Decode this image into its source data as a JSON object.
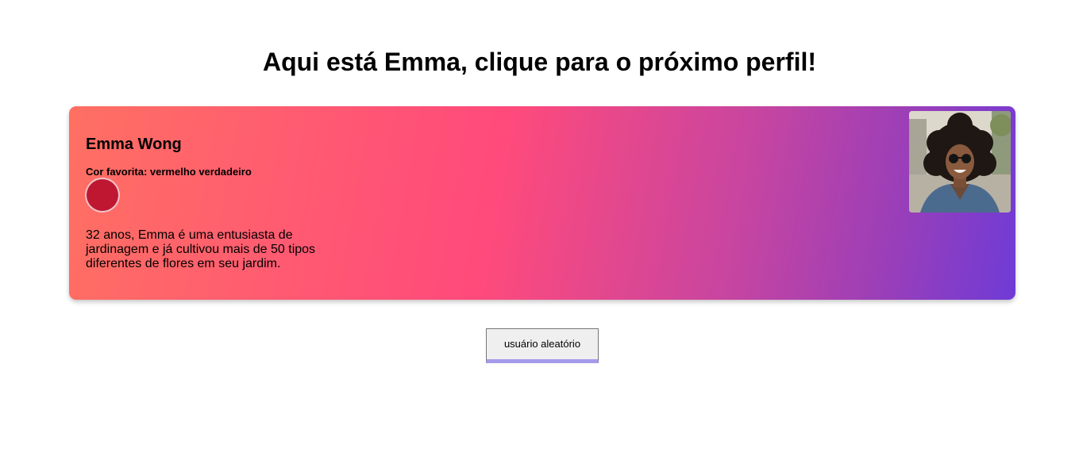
{
  "page": {
    "title": "Aqui está Emma, clique para o próximo perfil!"
  },
  "profile": {
    "name": "Emma Wong",
    "favorite_color_label": "Cor favorita: vermelho verdadeiro",
    "favorite_color_hex": "#bf1732",
    "bio": "32 anos, Emma é uma entusiasta de jardinagem e já cultivou mais de 50 tipos diferentes de flores em seu jardim.",
    "avatar_icon": "profile-photo"
  },
  "actions": {
    "random_user_label": "usuário aleatório"
  },
  "colors": {
    "card_gradient_start": "#ff7062",
    "card_gradient_mid": "#ff4a7b",
    "card_gradient_end": "#6f3bd6",
    "button_accent": "#a59bea"
  }
}
